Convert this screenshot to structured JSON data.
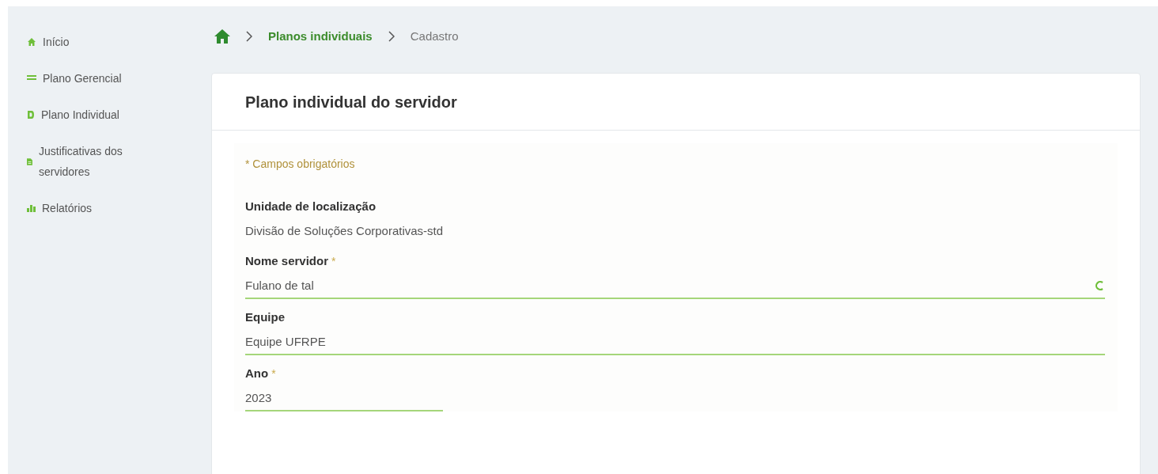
{
  "sidebar": {
    "items": [
      {
        "label": "Início"
      },
      {
        "label": "Plano Gerencial"
      },
      {
        "label": "Plano Individual"
      },
      {
        "label": "Justificativas dos servidores"
      },
      {
        "label": "Relatórios"
      }
    ]
  },
  "breadcrumb": {
    "items": [
      {
        "label": "Planos individuais",
        "selected": false
      },
      {
        "label": "Cadastro",
        "selected": true
      }
    ]
  },
  "card": {
    "title": "Plano individual do servidor",
    "required_note": "* Campos obrigatórios",
    "fields": [
      {
        "kind": "static",
        "label": "Unidade de localização",
        "value": "Divisão de Soluções Corporativas-std"
      },
      {
        "kind": "input",
        "label": "Nome servidor",
        "required_mark": "*",
        "value": "Fulano de tal",
        "loading": true
      },
      {
        "kind": "input",
        "label": "Equipe",
        "value": "Equipe UFRPE",
        "loading": false
      },
      {
        "kind": "short_input",
        "label": "Ano",
        "required_mark": "*",
        "value": "2023",
        "loading": false
      }
    ]
  }
}
